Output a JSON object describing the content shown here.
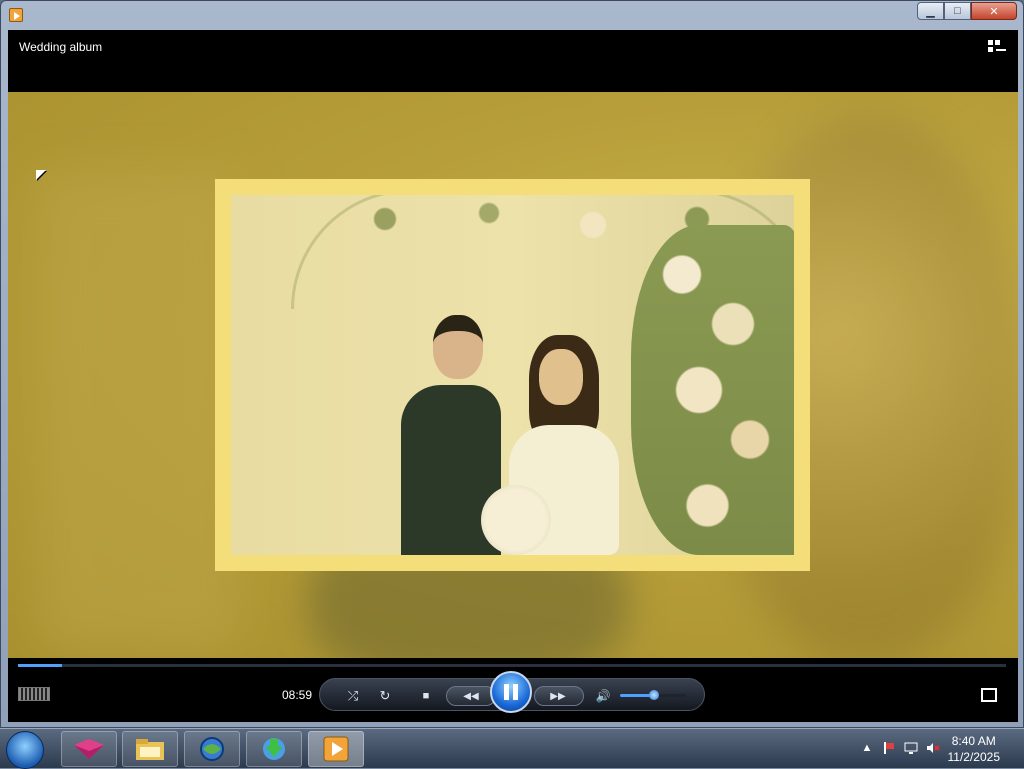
{
  "window": {
    "min_glyph": "▁",
    "max_glyph": "□",
    "close_glyph": "✕"
  },
  "player": {
    "title": "Wedding album",
    "elapsed": "08:59",
    "progress_fraction": 0.045,
    "volume_fraction": 0.52,
    "controls": {
      "shuffle_glyph": "⤮",
      "repeat_glyph": "↻",
      "stop_glyph": "■",
      "previous_glyph": "◀◀",
      "next_glyph": "▶▶",
      "mute_glyph": "🔊"
    }
  },
  "taskbar": {
    "time": "8:40 AM",
    "date": "11/2/2025",
    "buttons": [
      "start",
      "app-pink",
      "file-explorer",
      "browser-globe",
      "download-manager",
      "media-player"
    ]
  },
  "colors": {
    "accent": "#4fa0ff",
    "frame": "#f3de7a",
    "tint": "#b79e3a"
  }
}
